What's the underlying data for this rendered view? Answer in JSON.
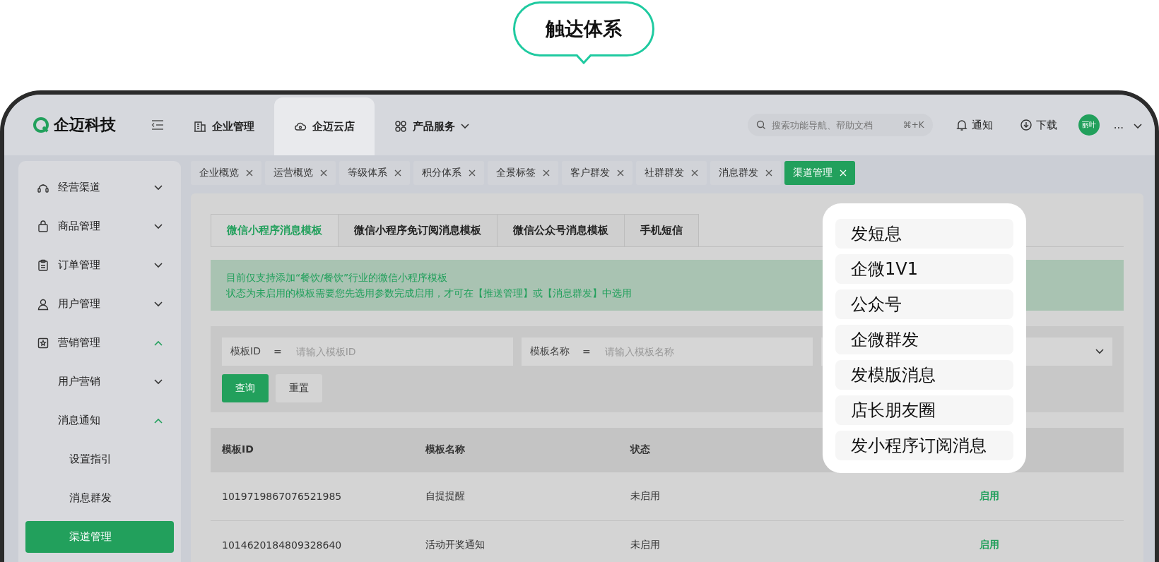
{
  "bubble": {
    "title": "触达体系"
  },
  "header": {
    "logo": "企迈科技",
    "nav": [
      {
        "label": "企业管理",
        "selected": false
      },
      {
        "label": "企迈云店",
        "selected": true
      },
      {
        "label": "产品服务",
        "selected": false
      }
    ],
    "search": {
      "placeholder": "搜索功能导航、帮助文档",
      "shortcut": "⌘+K"
    },
    "actions": [
      {
        "label": "通知"
      },
      {
        "label": "下载"
      }
    ],
    "avatar": "丽叶",
    "more": "..."
  },
  "sidebar": {
    "items": [
      {
        "label": "经营渠道",
        "expanded": false,
        "selected": false
      },
      {
        "label": "商品管理",
        "expanded": false,
        "selected": false
      },
      {
        "label": "订单管理",
        "expanded": false,
        "selected": false
      },
      {
        "label": "用户管理",
        "expanded": false,
        "selected": false
      },
      {
        "label": "营销管理",
        "expanded": true,
        "selected": false,
        "children": [
          {
            "label": "用户营销",
            "expanded": false,
            "selected": false
          },
          {
            "label": "消息通知",
            "expanded": true,
            "selected": false,
            "children": [
              {
                "label": "设置指引",
                "selected": false
              },
              {
                "label": "消息群发",
                "selected": false
              },
              {
                "label": "渠道管理",
                "selected": true
              }
            ]
          }
        ]
      }
    ]
  },
  "page_tabs": [
    {
      "label": "企业概览",
      "selected": false
    },
    {
      "label": "运营概览",
      "selected": false
    },
    {
      "label": "等级体系",
      "selected": false
    },
    {
      "label": "积分体系",
      "selected": false
    },
    {
      "label": "全景标签",
      "selected": false
    },
    {
      "label": "客户群发",
      "selected": false
    },
    {
      "label": "社群群发",
      "selected": false
    },
    {
      "label": "消息群发",
      "selected": false
    },
    {
      "label": "渠道管理",
      "selected": true
    }
  ],
  "template_tabs": [
    {
      "label": "微信小程序消息模板",
      "selected": true
    },
    {
      "label": "微信小程序免订阅消息模板",
      "selected": false
    },
    {
      "label": "微信公众号消息模板",
      "selected": false
    },
    {
      "label": "手机短信",
      "selected": false
    }
  ],
  "notice": [
    "目前仅支持添加“餐饮/餐饮”行业的微信小程序模板",
    "状态为未启用的模板需要您先选用参数完成启用，才可在【推送管理】或【消息群发】中选用"
  ],
  "filters": [
    {
      "kind": "input",
      "label": "模板ID",
      "operator": "=",
      "placeholder": "请输入模板ID"
    },
    {
      "kind": "input",
      "label": "模板名称",
      "operator": "=",
      "placeholder": "请输入模板名称"
    },
    {
      "kind": "select"
    }
  ],
  "buttons": [
    {
      "label": "查询",
      "kind": "primary"
    },
    {
      "label": "重置",
      "kind": "default"
    }
  ],
  "table": {
    "columns": [
      "模板ID",
      "模板名称",
      "状态"
    ],
    "rows": [
      {
        "id": "1019719867076521985",
        "name": "自提提醒",
        "status": "未启用",
        "action": "启用"
      },
      {
        "id": "1014620184809328640",
        "name": "活动开奖通知",
        "status": "未启用",
        "action": "启用"
      }
    ]
  },
  "popup": {
    "items": [
      "发短息",
      "企微1V1",
      "公众号",
      "企微群发",
      "发模版消息",
      "店长朋友圈",
      "发小程序订阅消息"
    ]
  }
}
